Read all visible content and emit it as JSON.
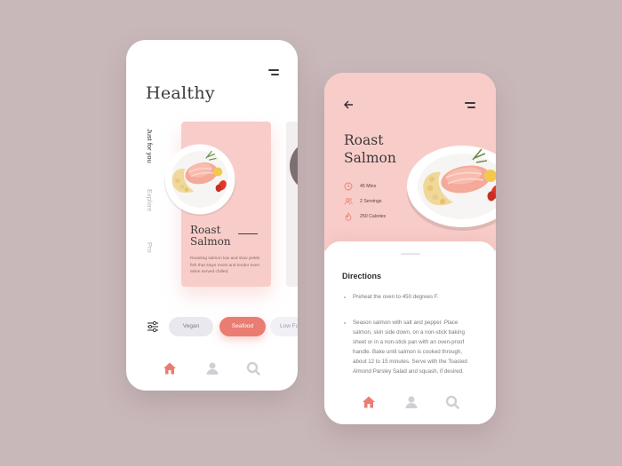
{
  "colors": {
    "background": "#c9b8ba",
    "card_pink": "#f8cdc9",
    "accent": "#eb7c72",
    "text_dark": "#3a3a3a"
  },
  "screen_home": {
    "title": "Healthy",
    "vertical_tabs": [
      "Just for you",
      "Explore",
      "Pro"
    ],
    "active_tab": "Just for you",
    "featured_card": {
      "dish_name": "Roast Salmon",
      "description": "Roasting salmon low and slow yields fish that stays moist and tender even when served chilled."
    },
    "filter_chips": [
      {
        "label": "Vegan",
        "selected": false
      },
      {
        "label": "Seafood",
        "selected": true
      },
      {
        "label": "Low Fat",
        "selected": false
      }
    ],
    "bottom_nav": [
      "home-icon",
      "user-icon",
      "search-icon"
    ],
    "active_nav": "home-icon"
  },
  "screen_detail": {
    "dish_name": "Roast Salmon",
    "stats": [
      {
        "icon": "clock-icon",
        "text": "45 Mins"
      },
      {
        "icon": "servings-icon",
        "text": "2 Servings"
      },
      {
        "icon": "flame-icon",
        "text": "250 Calories"
      }
    ],
    "directions_heading": "Directions",
    "directions": [
      "Preheat the oven to 450 degrees F.",
      "Season salmon with salt and pepper. Place salmon, skin side down, on a non-stick baking sheet or in a non-stick pan with an oven-proof handle. Bake until salmon is cooked through, about 12 to 15 minutes. Serve with the Toasted Almond Parsley Salad and squash, if desired."
    ],
    "bottom_nav": [
      "home-icon",
      "user-icon",
      "search-icon"
    ],
    "active_nav": "home-icon"
  }
}
